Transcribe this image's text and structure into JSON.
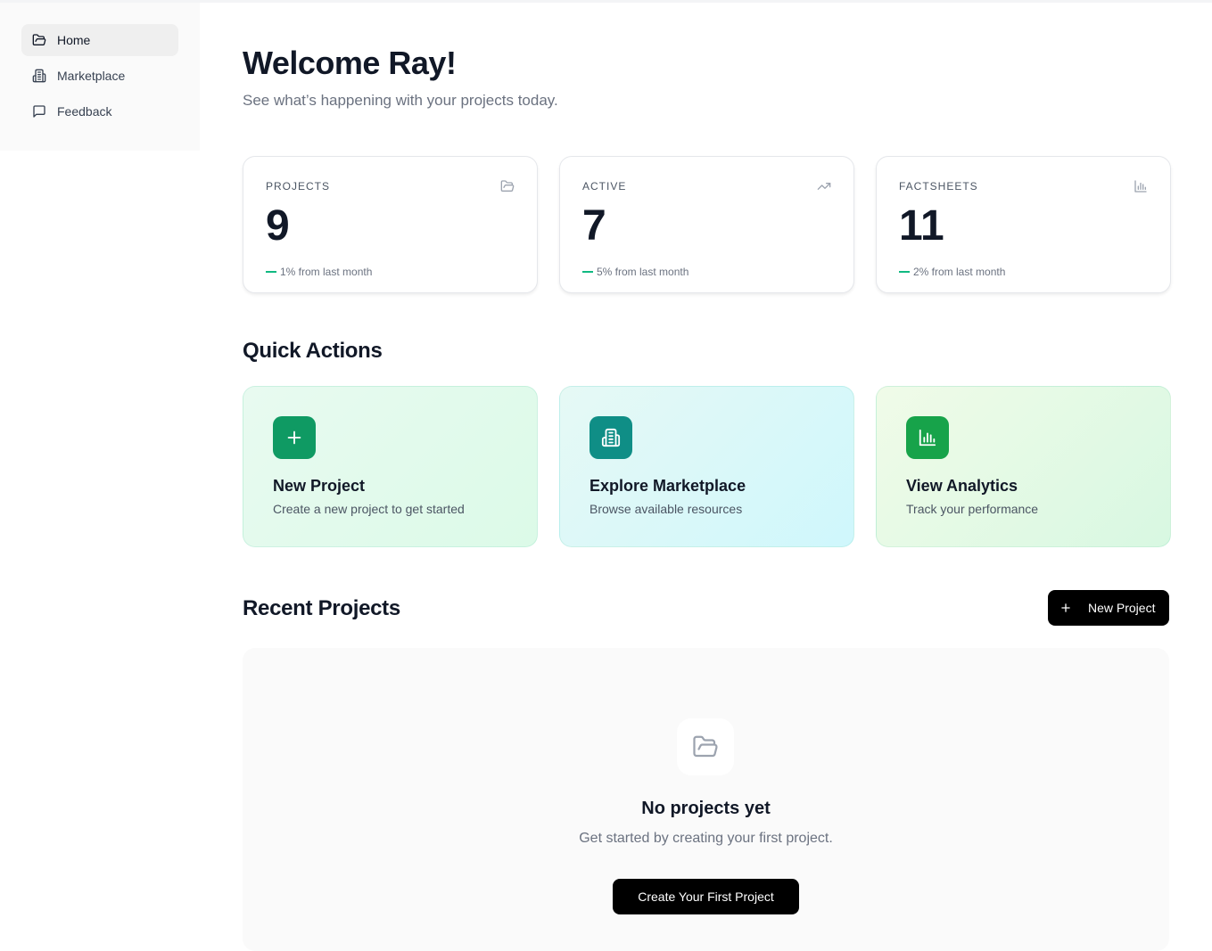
{
  "sidebar": {
    "items": [
      {
        "label": "Home",
        "icon": "folder-open-icon",
        "active": true
      },
      {
        "label": "Marketplace",
        "icon": "building-icon",
        "active": false
      },
      {
        "label": "Feedback",
        "icon": "message-square-icon",
        "active": false
      }
    ]
  },
  "header": {
    "title": "Welcome Ray!",
    "subtitle": "See what’s happening with your projects today."
  },
  "stats": [
    {
      "label": "PROJECTS",
      "value": "9",
      "change": "1% from last month",
      "icon": "folder-open-icon"
    },
    {
      "label": "ACTIVE",
      "value": "7",
      "change": "5% from last month",
      "icon": "trending-up-icon"
    },
    {
      "label": "FACTSHEETS",
      "value": "11",
      "change": "2% from last month",
      "icon": "bar-chart-icon"
    }
  ],
  "quick_actions": {
    "title": "Quick Actions",
    "cards": [
      {
        "title": "New Project",
        "description": "Create a new project to get started",
        "icon": "plus-icon",
        "color": "#0f9a63"
      },
      {
        "title": "Explore Marketplace",
        "description": "Browse available resources",
        "icon": "building-icon",
        "color": "#0f8e86"
      },
      {
        "title": "View Analytics",
        "description": "Track your performance",
        "icon": "bar-chart-icon",
        "color": "#17a34a"
      }
    ]
  },
  "recent_projects": {
    "title": "Recent Projects",
    "new_button": "New Project",
    "empty_title": "No projects yet",
    "empty_description": "Get started by creating your first project.",
    "empty_button": "Create Your First Project"
  },
  "colors": {
    "accent_green": "#10b981",
    "primary_button": "#000000"
  }
}
